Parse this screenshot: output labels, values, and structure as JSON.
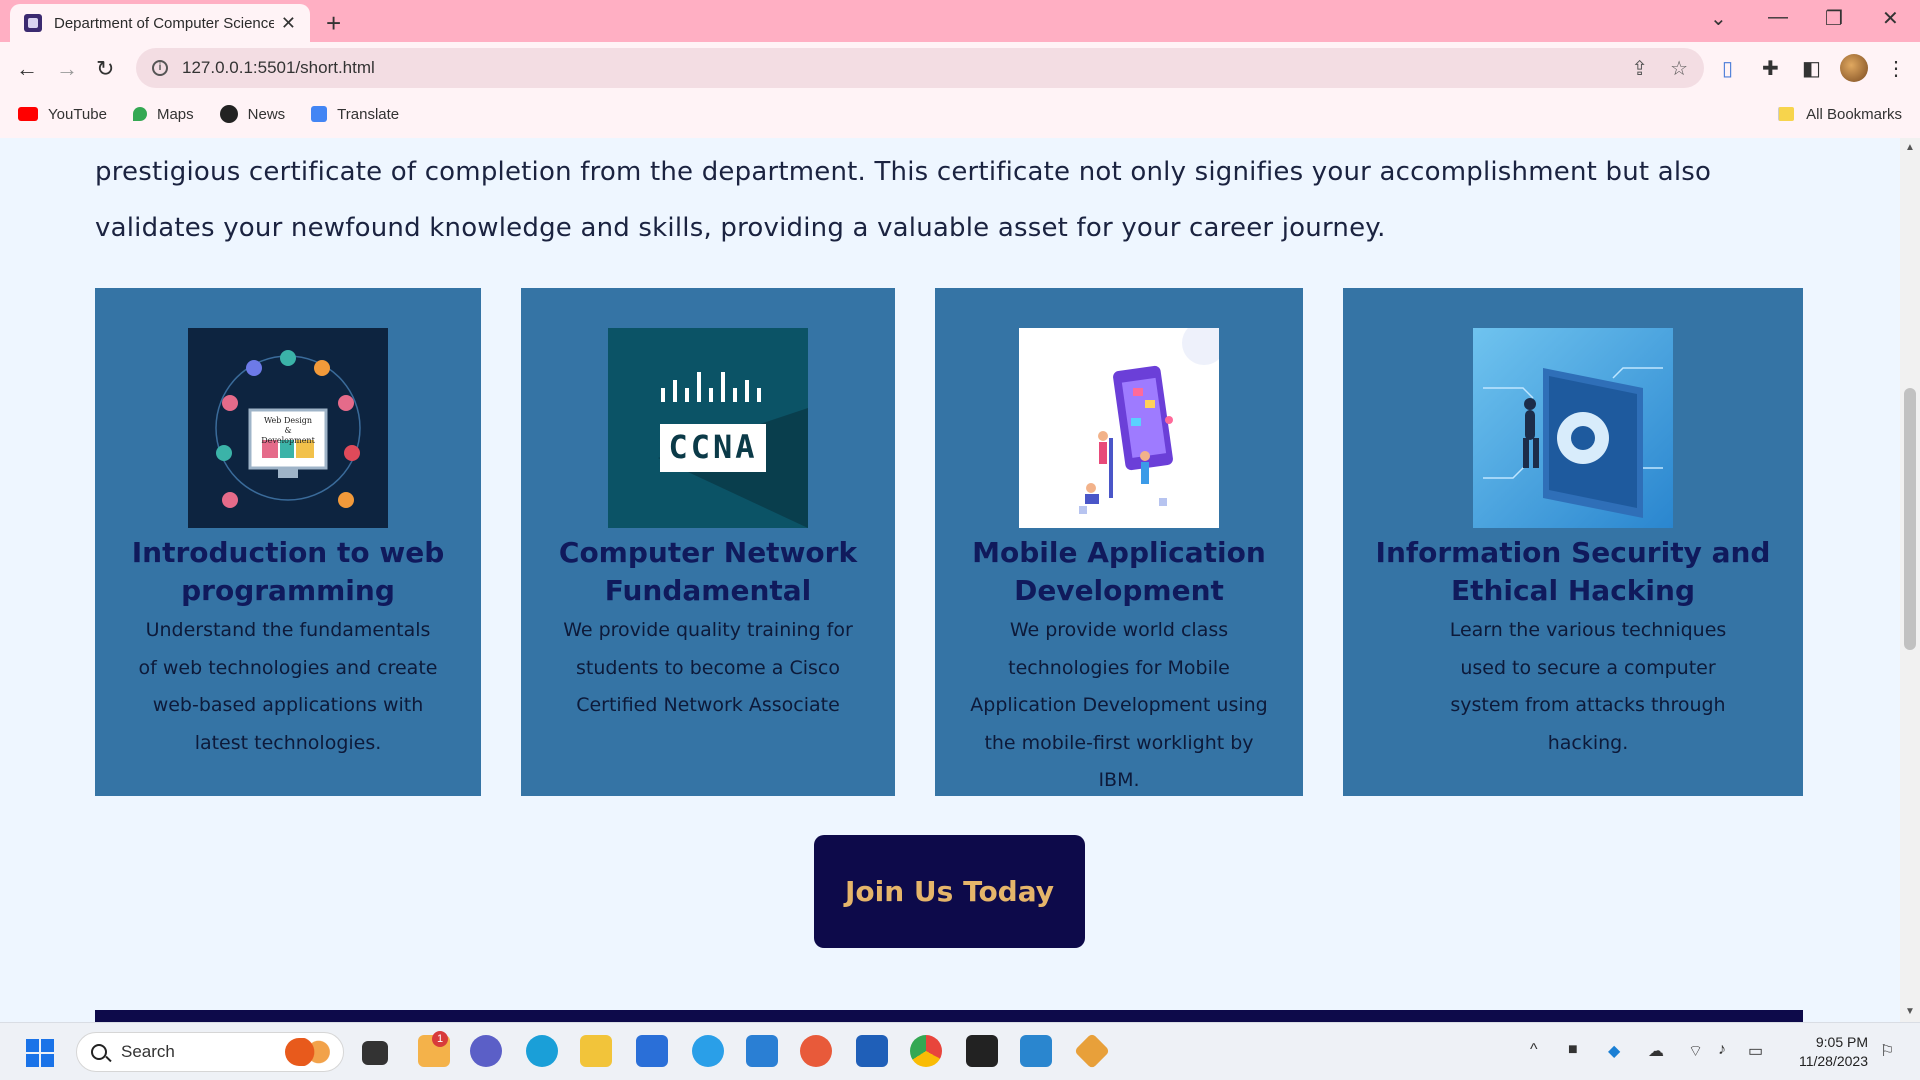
{
  "browser": {
    "tab_title": "Department of Computer Science",
    "url": "127.0.0.1:5501/short.html",
    "bookmarks": [
      {
        "label": "YouTube",
        "icon": "youtube-icon",
        "color": "#ff0000"
      },
      {
        "label": "Maps",
        "icon": "maps-icon",
        "color": "#34a853"
      },
      {
        "label": "News",
        "icon": "news-icon",
        "color": "#222222"
      },
      {
        "label": "Translate",
        "icon": "translate-icon",
        "color": "#4285f4"
      }
    ],
    "all_bookmarks": "All Bookmarks"
  },
  "page": {
    "intro_text": "prestigious certificate of completion from the department. This certificate not only signifies your accomplishment but also validates your newfound knowledge and skills, providing a valuable asset for your career journey.",
    "courses": [
      {
        "title": "Introduction to web programming",
        "description": "Understand the fundamentals of web technologies and create web-based applications with latest technologies.",
        "image_label": "Web Design & Development",
        "image_icon": "web-design-illustration"
      },
      {
        "title": "Computer Network Fundamental",
        "description": "We provide quality training for students to become a Cisco Certified Network Associate",
        "image_label": "CCNA",
        "image_icon": "ccna-logo"
      },
      {
        "title": "Mobile Application Development",
        "description": "We provide world class technologies for Mobile Application Development using the mobile-first worklight by IBM.",
        "image_icon": "mobile-development-illustration"
      },
      {
        "title": "Information Security and Ethical Hacking",
        "description": "Learn the various techniques used to secure a computer system from attacks through hacking.",
        "image_icon": "security-lock-illustration"
      }
    ],
    "cta_label": "Join Us Today",
    "colors": {
      "card_bg": "#3574a5",
      "title": "#101a5c",
      "button_bg": "#0d0a4a",
      "button_text": "#e5b56a"
    }
  },
  "taskbar": {
    "search_placeholder": "Search",
    "time": "9:05 PM",
    "date": "11/28/2023",
    "notification_badge": "1"
  }
}
